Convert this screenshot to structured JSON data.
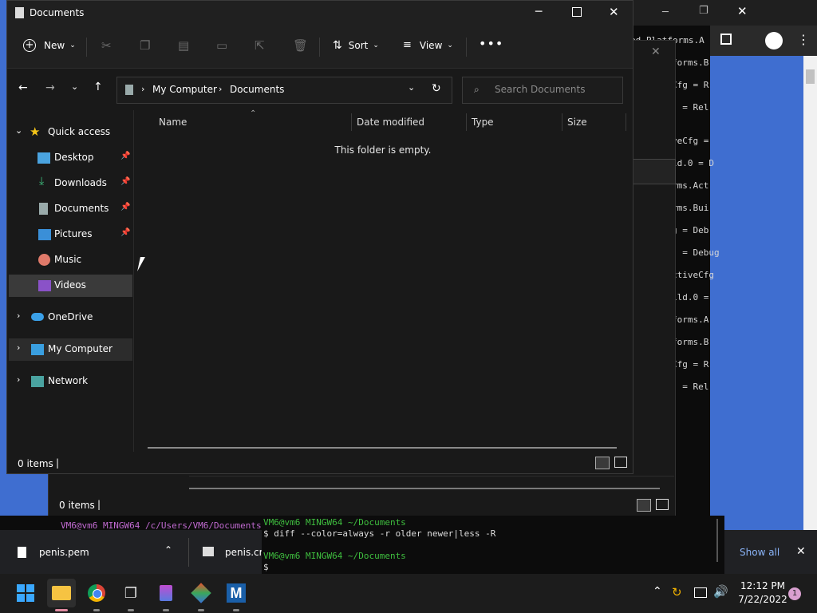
{
  "explorer": {
    "title": "Documents",
    "toolbar": {
      "new_label": "New",
      "sort_label": "Sort",
      "view_label": "View"
    },
    "address": {
      "root": "My Computer",
      "current": "Documents"
    },
    "search": {
      "placeholder": "Search Documents"
    },
    "sidebar": {
      "quick_access": "Quick access",
      "items": [
        {
          "label": "Desktop",
          "pinned": true
        },
        {
          "label": "Downloads",
          "pinned": true
        },
        {
          "label": "Documents",
          "pinned": true
        },
        {
          "label": "Pictures",
          "pinned": true
        },
        {
          "label": "Music",
          "pinned": false
        },
        {
          "label": "Videos",
          "pinned": false
        }
      ],
      "onedrive": "OneDrive",
      "my_computer": "My Computer",
      "network": "Network"
    },
    "columns": {
      "name": "Name",
      "date_modified": "Date modified",
      "type": "Type",
      "size": "Size"
    },
    "empty_message": "This folder is empty.",
    "status": "0 items"
  },
  "second_window": {
    "status": "0 items"
  },
  "bg_terminal_lines": [
    "ed_Platforms.A",
    "forms.B",
    "Cfg = R",
    ") = Rel",
    "",
    "veCfg =",
    "ld.0 = D",
    "rms.Act",
    "rms.Bui",
    "g = Deb",
    ") = Debug",
    "ctiveCfg",
    "ild.0 =",
    "forms.A",
    "forms.B",
    "Cfg = R",
    ") = Rel"
  ],
  "terminal": {
    "left_prompt": "VM6@vm6 MINGW64 /c/Users/VM6/Documents",
    "left_cmd": "$ ",
    "prompt1": "VM6@vm6 MINGW64 ~/Documents",
    "cmd1": "$ diff --color=always -r older newer|less -R",
    "prompt2": "VM6@vm6 MINGW64 ~/Documents",
    "cmd2": "$ "
  },
  "downloads": {
    "item1": "penis.pem",
    "item2": "penis.cr",
    "show_all": "Show all"
  },
  "taskbar": {
    "time": "12:12 PM",
    "date": "7/22/2022",
    "notification_count": "1"
  }
}
